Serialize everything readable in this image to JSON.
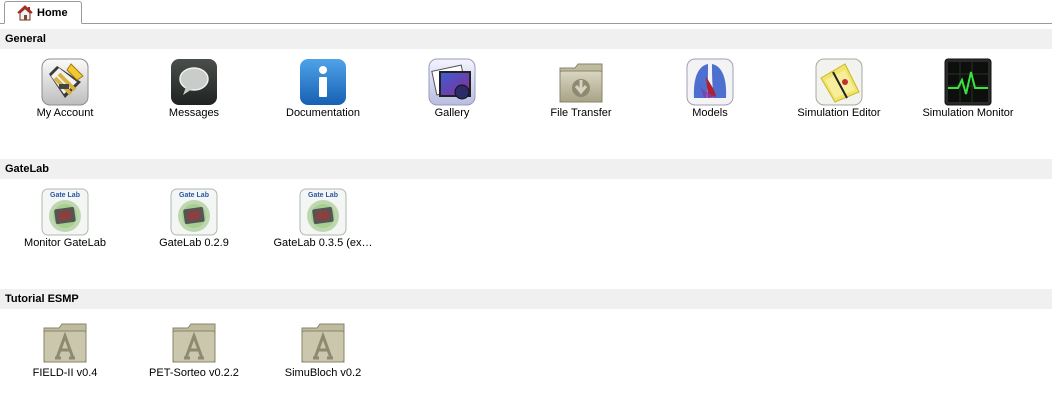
{
  "tabs": [
    {
      "label": "Home",
      "icon": "home-icon"
    }
  ],
  "sections": [
    {
      "title": "General",
      "apps": [
        {
          "label": "My Account",
          "icon": "my-account-icon"
        },
        {
          "label": "Messages",
          "icon": "messages-icon"
        },
        {
          "label": "Documentation",
          "icon": "documentation-icon"
        },
        {
          "label": "Gallery",
          "icon": "gallery-icon"
        },
        {
          "label": "File Transfer",
          "icon": "file-transfer-icon"
        },
        {
          "label": "Models",
          "icon": "models-icon"
        },
        {
          "label": "Simulation Editor",
          "icon": "simulation-editor-icon"
        },
        {
          "label": "Simulation Monitor",
          "icon": "simulation-monitor-icon"
        }
      ]
    },
    {
      "title": "GateLab",
      "apps": [
        {
          "label": "Monitor GateLab",
          "icon": "gatelab-icon",
          "icon_text": "Gate Lab"
        },
        {
          "label": "GateLab 0.2.9",
          "icon": "gatelab-icon",
          "icon_text": "Gate Lab"
        },
        {
          "label": "GateLab 0.3.5 (ex…",
          "icon": "gatelab-icon",
          "icon_text": "Gate Lab"
        }
      ]
    },
    {
      "title": "Tutorial ESMP",
      "apps": [
        {
          "label": "FIELD-II v0.4",
          "icon": "application-folder-icon"
        },
        {
          "label": "PET-Sorteo v0.2.2",
          "icon": "application-folder-icon"
        },
        {
          "label": "SimuBloch v0.2",
          "icon": "application-folder-icon"
        }
      ]
    }
  ]
}
